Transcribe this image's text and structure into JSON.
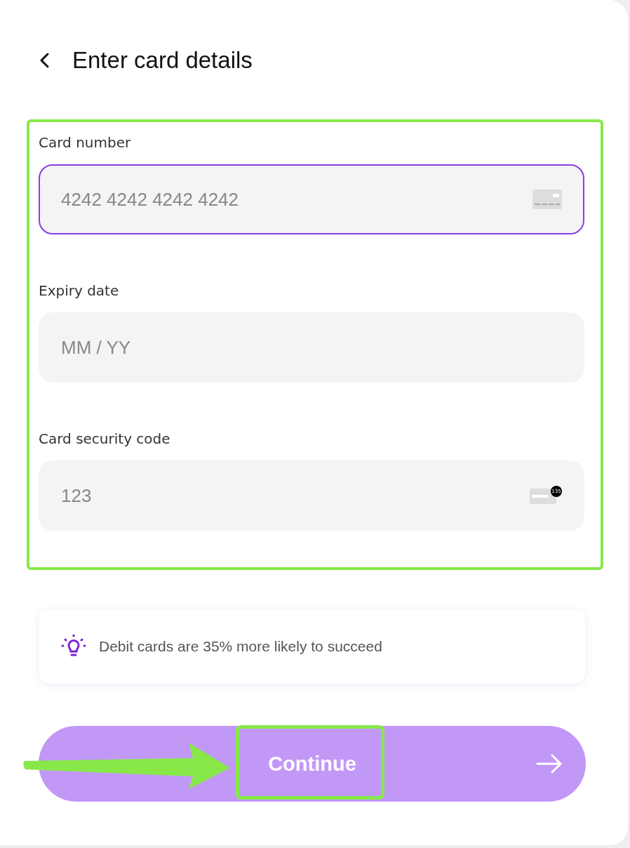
{
  "header": {
    "title": "Enter card details"
  },
  "fields": [
    {
      "label": "Card number",
      "placeholder": "4242 4242 4242 4242",
      "focused": true,
      "kind": "card"
    },
    {
      "label": "Expiry date",
      "placeholder": "MM / YY",
      "focused": false,
      "kind": "plain"
    },
    {
      "label": "Card security code",
      "placeholder": "123",
      "focused": false,
      "kind": "cvc",
      "badge": "135"
    }
  ],
  "tip": {
    "text": "Debit cards are 35% more likely to succeed"
  },
  "continue_button": {
    "label": "Continue"
  }
}
